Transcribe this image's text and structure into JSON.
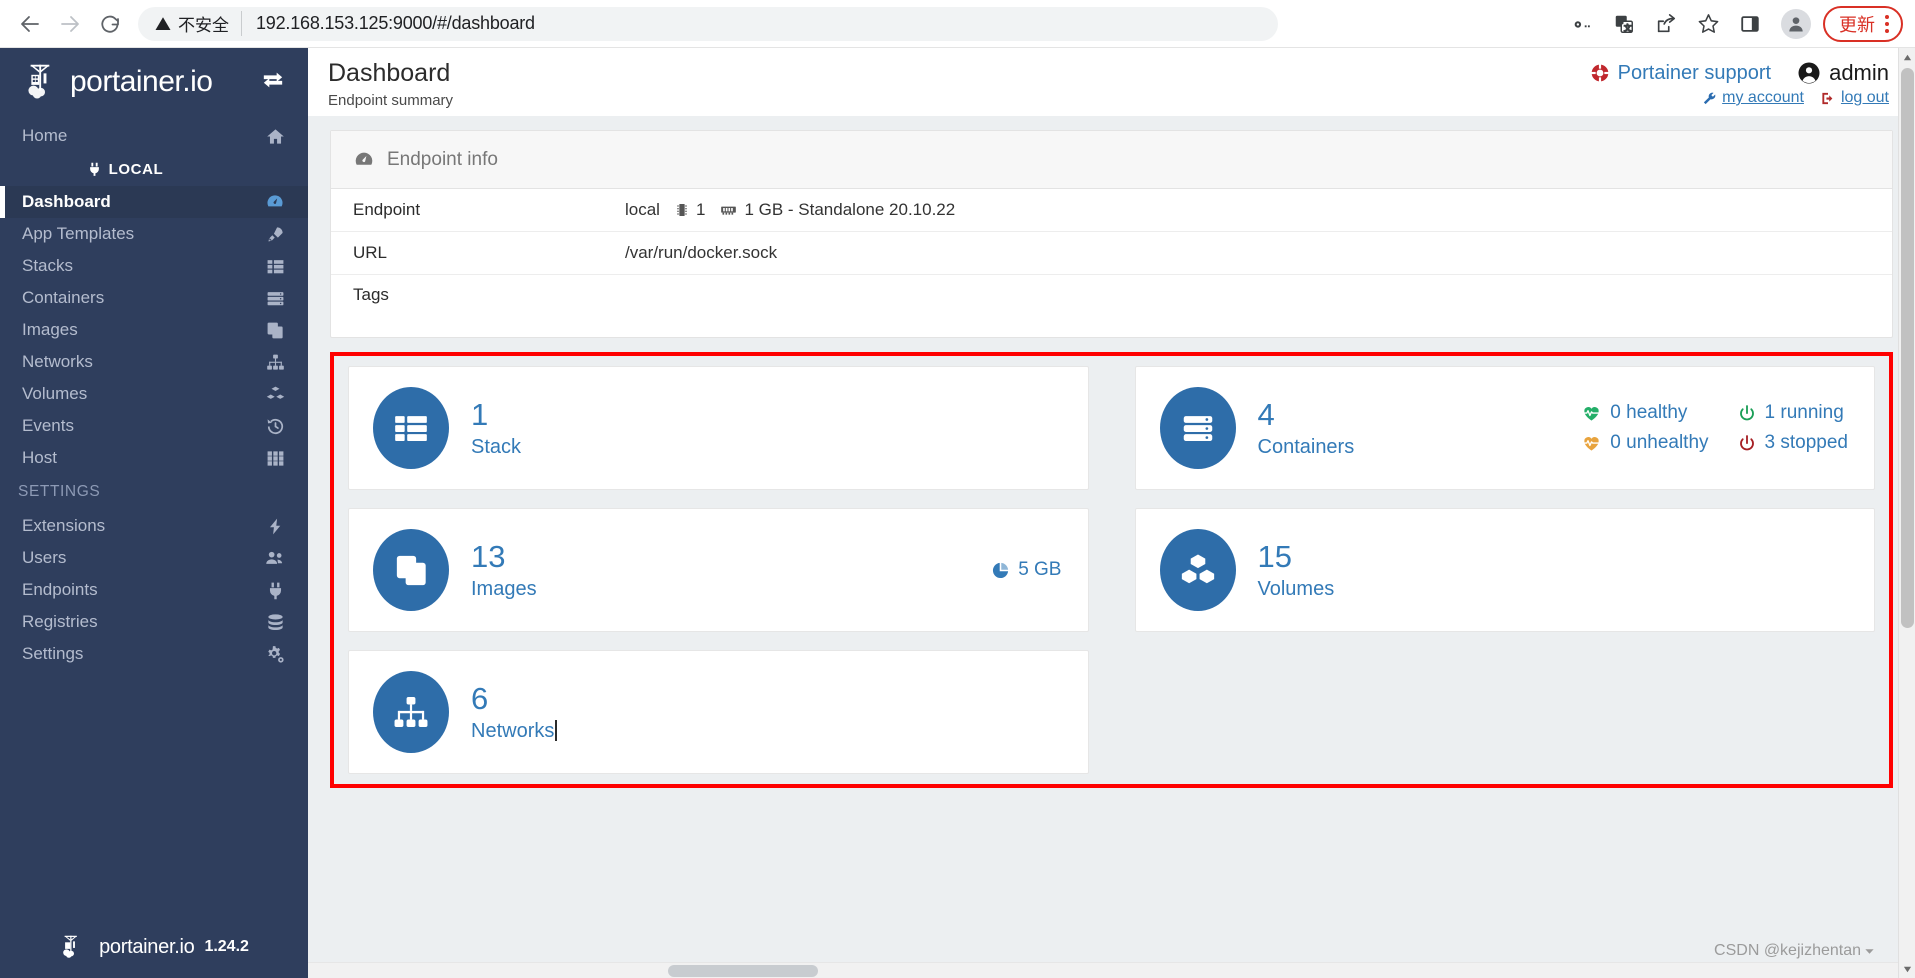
{
  "browser": {
    "back_label": "Back",
    "forward_label": "Forward",
    "reload_label": "Reload",
    "security_text": "不安全",
    "url": "192.168.153.125:9000/#/dashboard",
    "actions": [
      {
        "name": "password-key-icon",
        "label": "Passwords"
      },
      {
        "name": "translate-icon",
        "label": "Translate"
      },
      {
        "name": "share-icon",
        "label": "Share"
      },
      {
        "name": "bookmark-star-icon",
        "label": "Bookmark"
      },
      {
        "name": "side-panel-icon",
        "label": "Side panel"
      }
    ],
    "profile_label": "Profile",
    "update_label": "更新",
    "menu_label": "Customize and control"
  },
  "sidebar": {
    "logo_text": "portainer.io",
    "toggle_label": "Toggle sidebar",
    "local_label": "LOCAL",
    "items": [
      {
        "label": "Home",
        "icon": "home-icon",
        "active": false
      },
      {
        "label": "Dashboard",
        "icon": "dashboard-icon",
        "active": true
      },
      {
        "label": "App Templates",
        "icon": "rocket-icon",
        "active": false
      },
      {
        "label": "Stacks",
        "icon": "stacks-icon",
        "active": false
      },
      {
        "label": "Containers",
        "icon": "containers-icon",
        "active": false
      },
      {
        "label": "Images",
        "icon": "images-icon",
        "active": false
      },
      {
        "label": "Networks",
        "icon": "networks-icon",
        "active": false
      },
      {
        "label": "Volumes",
        "icon": "volumes-icon",
        "active": false
      },
      {
        "label": "Events",
        "icon": "history-icon",
        "active": false
      },
      {
        "label": "Host",
        "icon": "grid-icon",
        "active": false
      }
    ],
    "settings_section_label": "SETTINGS",
    "settings_items": [
      {
        "label": "Extensions",
        "icon": "bolt-icon"
      },
      {
        "label": "Users",
        "icon": "users-icon"
      },
      {
        "label": "Endpoints",
        "icon": "plug-icon"
      },
      {
        "label": "Registries",
        "icon": "database-icon"
      },
      {
        "label": "Settings",
        "icon": "gears-icon"
      }
    ],
    "footer_logo_text": "portainer.io",
    "version": "1.24.2"
  },
  "header": {
    "title": "Dashboard",
    "subtitle": "Endpoint summary",
    "support_label": "Portainer support",
    "support_icon": "lifering-icon",
    "user_name": "admin",
    "user_icon": "user-circle-icon",
    "my_account_label": "my account",
    "my_account_icon": "wrench-icon",
    "log_out_label": "log out",
    "log_out_icon": "sign-out-icon"
  },
  "endpoint_info": {
    "panel_title": "Endpoint info",
    "panel_icon": "tachometer-icon",
    "rows": [
      {
        "key": "Endpoint",
        "value": "local",
        "cpu": "1",
        "memory": "1 GB - Standalone 20.10.22"
      },
      {
        "key": "URL",
        "value": "/var/run/docker.sock"
      },
      {
        "key": "Tags",
        "value": ""
      }
    ]
  },
  "stats": {
    "stack": {
      "count": "1",
      "label": "Stack",
      "icon": "stacks-icon"
    },
    "containers": {
      "count": "4",
      "label": "Containers",
      "icon": "containers-icon",
      "healthy": "0 healthy",
      "unhealthy": "0 unhealthy",
      "running": "1 running",
      "stopped": "3 stopped"
    },
    "images": {
      "count": "13",
      "label": "Images",
      "icon": "images-icon",
      "size": "5 GB",
      "size_icon": "pie-chart-icon"
    },
    "volumes": {
      "count": "15",
      "label": "Volumes",
      "icon": "volumes-icon"
    },
    "networks": {
      "count": "6",
      "label": "Networks",
      "icon": "networks-icon"
    }
  },
  "colors": {
    "sidebar_bg": "#2f3e5d",
    "accent_blue": "#337ab7",
    "icon_circle": "#2e6da9",
    "healthy_green": "#23ae68",
    "unhealthy_orange": "#e8a33d",
    "running_green": "#1a9e56",
    "stopped_red": "#a61f24",
    "annotation_red": "#ff0000",
    "update_red": "#d93025"
  },
  "watermark": {
    "text": "CSDN @kejizhentan"
  }
}
